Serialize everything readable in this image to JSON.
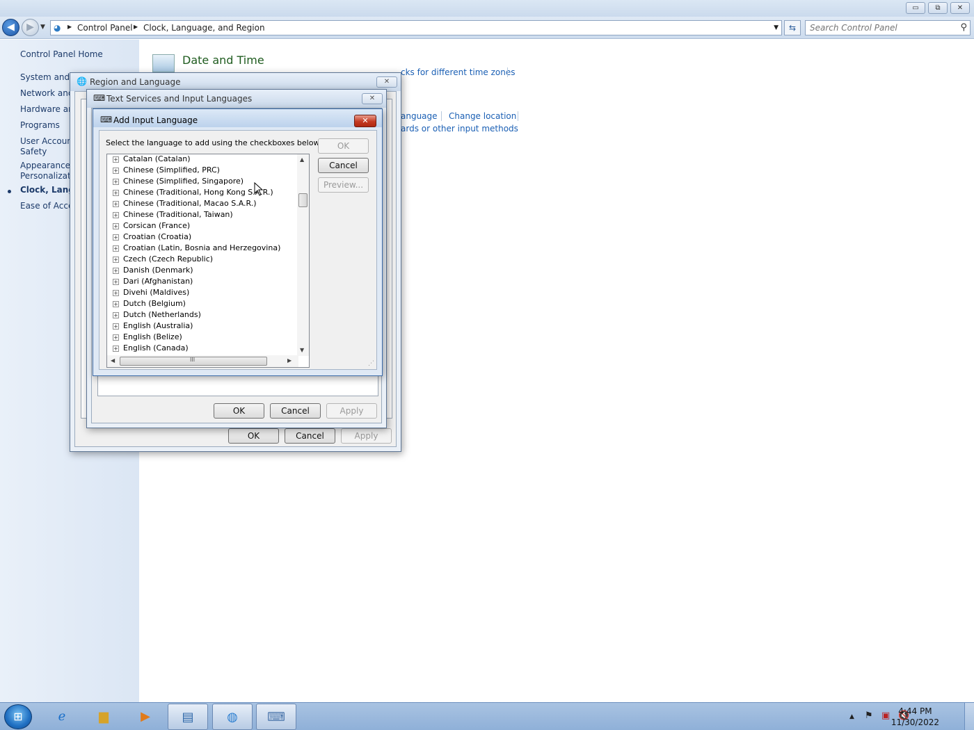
{
  "window": {
    "minimize": "▭",
    "restore": "⧉",
    "close": "✕"
  },
  "address_bar": {
    "breadcrumbs": [
      "Control Panel",
      "Clock, Language, and Region"
    ],
    "search_placeholder": "Search Control Panel"
  },
  "left_nav": {
    "items": [
      {
        "label": "Control Panel Home"
      },
      {
        "label": "System and S"
      },
      {
        "label": "Network and"
      },
      {
        "label": "Hardware and"
      },
      {
        "label": "Programs"
      },
      {
        "label": "User Account"
      },
      {
        "label": "Safety"
      },
      {
        "label": "Appearance a"
      },
      {
        "label": "Personalizatic"
      },
      {
        "label": "Clock, Langu"
      },
      {
        "label": "Ease of Acces"
      }
    ]
  },
  "main": {
    "section_title": "Date and Time",
    "links": {
      "time_zones": "cks for different time zones",
      "language": "anguage",
      "change_location": "Change location",
      "keyboards": "ards or other input methods"
    }
  },
  "region_dialog": {
    "title": "Region and Language",
    "ok": "OK",
    "cancel": "Cancel",
    "apply": "Apply"
  },
  "text_services_dialog": {
    "title": "Text Services and Input Languages",
    "ok": "OK",
    "cancel": "Cancel",
    "apply": "Apply"
  },
  "add_language_dialog": {
    "title": "Add Input Language",
    "instruction": "Select the language to add using the checkboxes below.",
    "ok": "OK",
    "cancel": "Cancel",
    "preview": "Preview...",
    "languages": [
      "Catalan (Catalan)",
      "Chinese (Simplified, PRC)",
      "Chinese (Simplified, Singapore)",
      "Chinese (Traditional, Hong Kong S.A.R.)",
      "Chinese (Traditional, Macao S.A.R.)",
      "Chinese (Traditional, Taiwan)",
      "Corsican (France)",
      "Croatian (Croatia)",
      "Croatian (Latin, Bosnia and Herzegovina)",
      "Czech (Czech Republic)",
      "Danish (Denmark)",
      "Dari (Afghanistan)",
      "Divehi (Maldives)",
      "Dutch (Belgium)",
      "Dutch (Netherlands)",
      "English (Australia)",
      "English (Belize)",
      "English (Canada)"
    ],
    "hscroll_grip": "III"
  },
  "taskbar": {
    "time": "4:44 PM",
    "date": "11/30/2022"
  }
}
